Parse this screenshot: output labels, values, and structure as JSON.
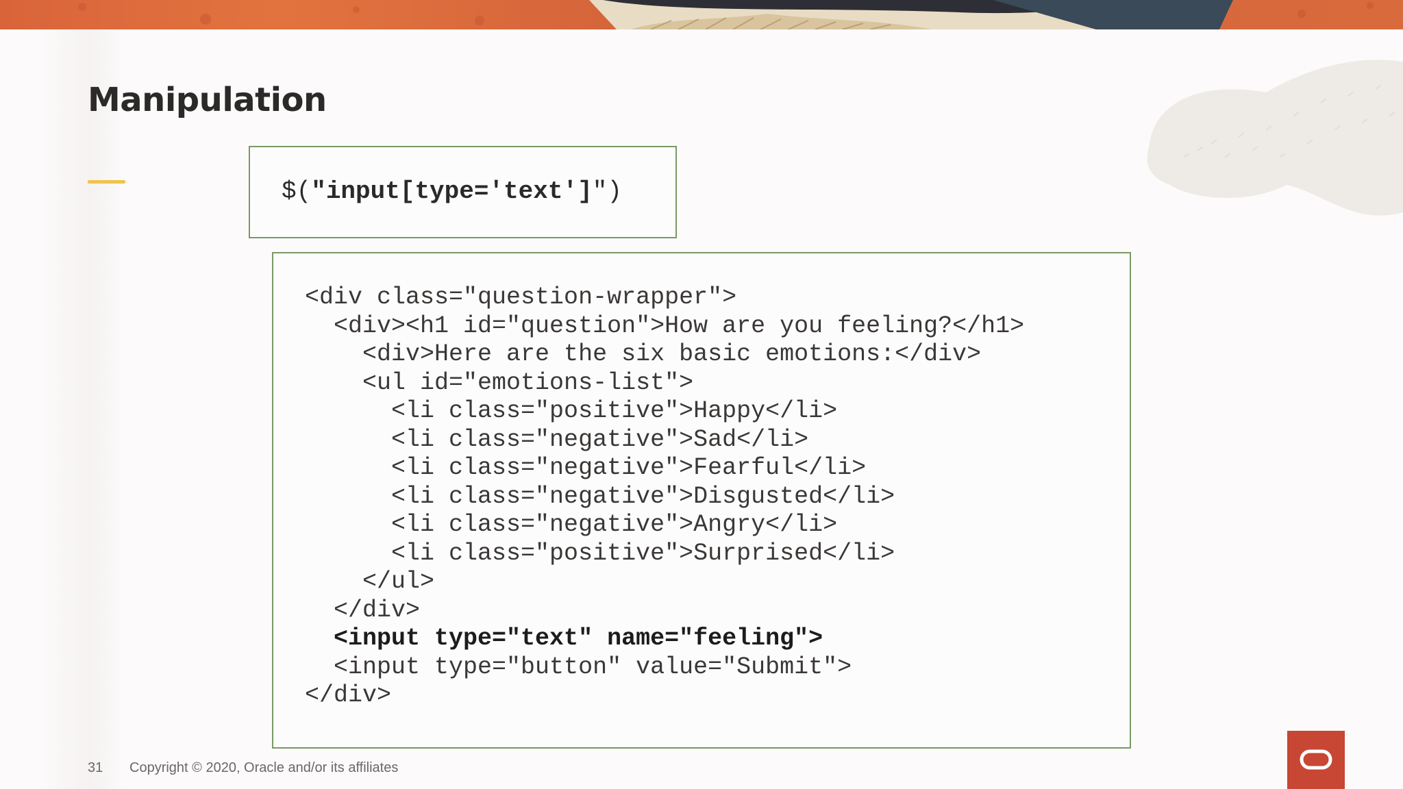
{
  "slide": {
    "title": "Manipulation",
    "selector": {
      "prefix": "$(",
      "quote_open": "\"",
      "bold_text": "input[type='text']",
      "quote_close": "\"",
      "suffix": ")"
    },
    "code_lines": [
      "<div class=\"question-wrapper\">",
      "  <div><h1 id=\"question\">How are you feeling?</h1>",
      "    <div>Here are the six basic emotions:</div>",
      "    <ul id=\"emotions-list\">",
      "      <li class=\"positive\">Happy</li>",
      "      <li class=\"negative\">Sad</li>",
      "      <li class=\"negative\">Fearful</li>",
      "      <li class=\"negative\">Disgusted</li>",
      "      <li class=\"negative\">Angry</li>",
      "      <li class=\"positive\">Surprised</li>",
      "    </ul>",
      "  </div>",
      "  <input type=\"text\" name=\"feeling\">",
      "  <input type=\"button\" value=\"Submit\">",
      "</div>"
    ]
  },
  "footer": {
    "page_number": "31",
    "copyright": "Copyright © 2020, Oracle and/or its affiliates"
  },
  "colors": {
    "banner": "#d9643a",
    "accent": "#f0c34a",
    "box_border": "#7a9966",
    "logo": "#c74634"
  },
  "icons": {
    "logo": "oracle-logo-icon"
  }
}
